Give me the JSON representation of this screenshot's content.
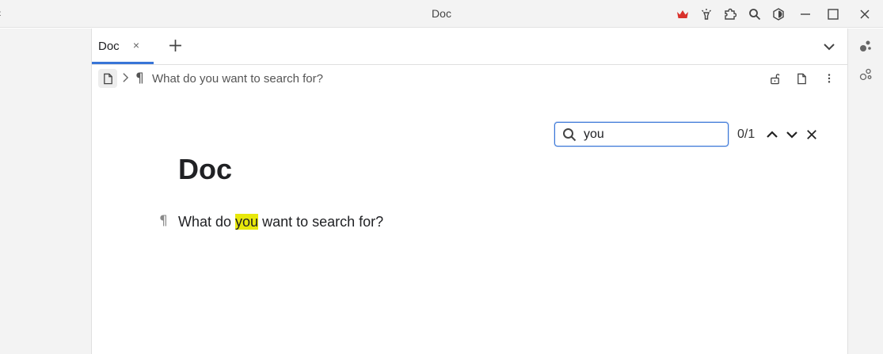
{
  "window": {
    "title": "Doc",
    "edge_glyph": "‹"
  },
  "titlebar_icons": [
    "crown-icon",
    "plugin-bulb-icon",
    "puzzle-icon",
    "search-icon",
    "theme-icon",
    "minimize-icon",
    "maximize-icon",
    "close-window-icon"
  ],
  "colors": {
    "accent": "#3875d7",
    "crown": "#d9312b",
    "highlight": "#e8e80a"
  },
  "tabs": [
    {
      "label": "Doc",
      "close_glyph": "×",
      "active": true
    }
  ],
  "breadcrumb": {
    "separator_icon": "chevron-right-icon",
    "block_glyph": "¶",
    "text": "What do you want to search for?"
  },
  "document": {
    "title": "Doc",
    "block_marker": "¶",
    "paragraph": {
      "before": "What do ",
      "match": "you",
      "after": " want to search for?"
    }
  },
  "find": {
    "value": "you",
    "count": "0/1"
  }
}
